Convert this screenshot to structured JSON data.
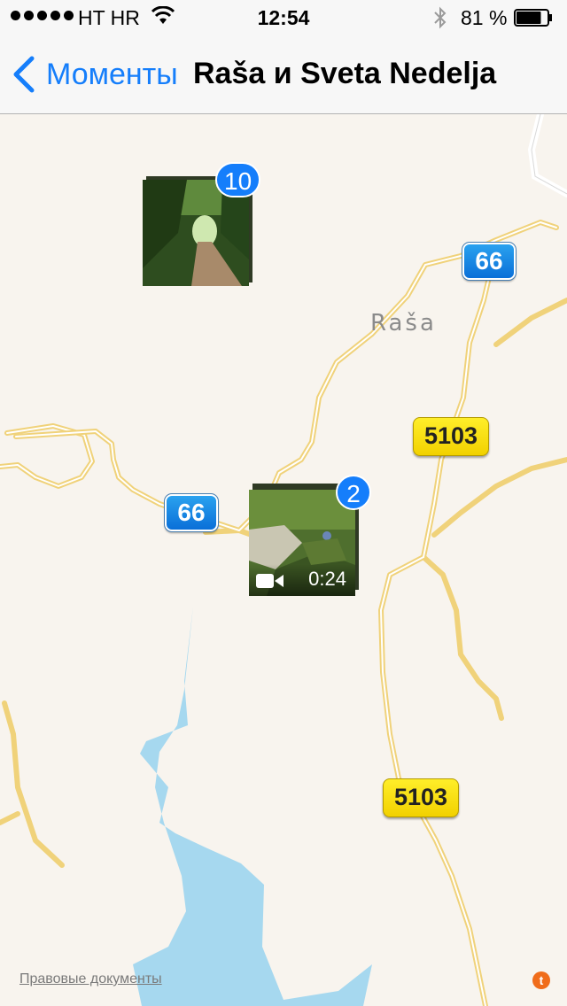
{
  "status_bar": {
    "carrier": "HT HR",
    "time": "12:54",
    "battery_percent": "81 %",
    "signal_bars": 5,
    "battery_level": 0.81
  },
  "nav": {
    "back_label": "Моменты",
    "title": "Raša и Sveta Nedelja"
  },
  "map": {
    "place_label": "Raša",
    "route_shields": [
      {
        "label": "66",
        "style": "blue"
      },
      {
        "label": "5103",
        "style": "yellow"
      },
      {
        "label": "66",
        "style": "blue"
      },
      {
        "label": "5103",
        "style": "yellow"
      }
    ],
    "clusters": [
      {
        "count": "10",
        "type": "photo"
      },
      {
        "count": "2",
        "type": "video",
        "duration": "0:24"
      }
    ],
    "legal_link": "Правовые документы",
    "info_icon": "tomtom-info-icon"
  },
  "colors": {
    "accent": "#157efb",
    "land": "#f8f4ee",
    "water": "#a6d8ef",
    "road": "#f7d67a"
  }
}
